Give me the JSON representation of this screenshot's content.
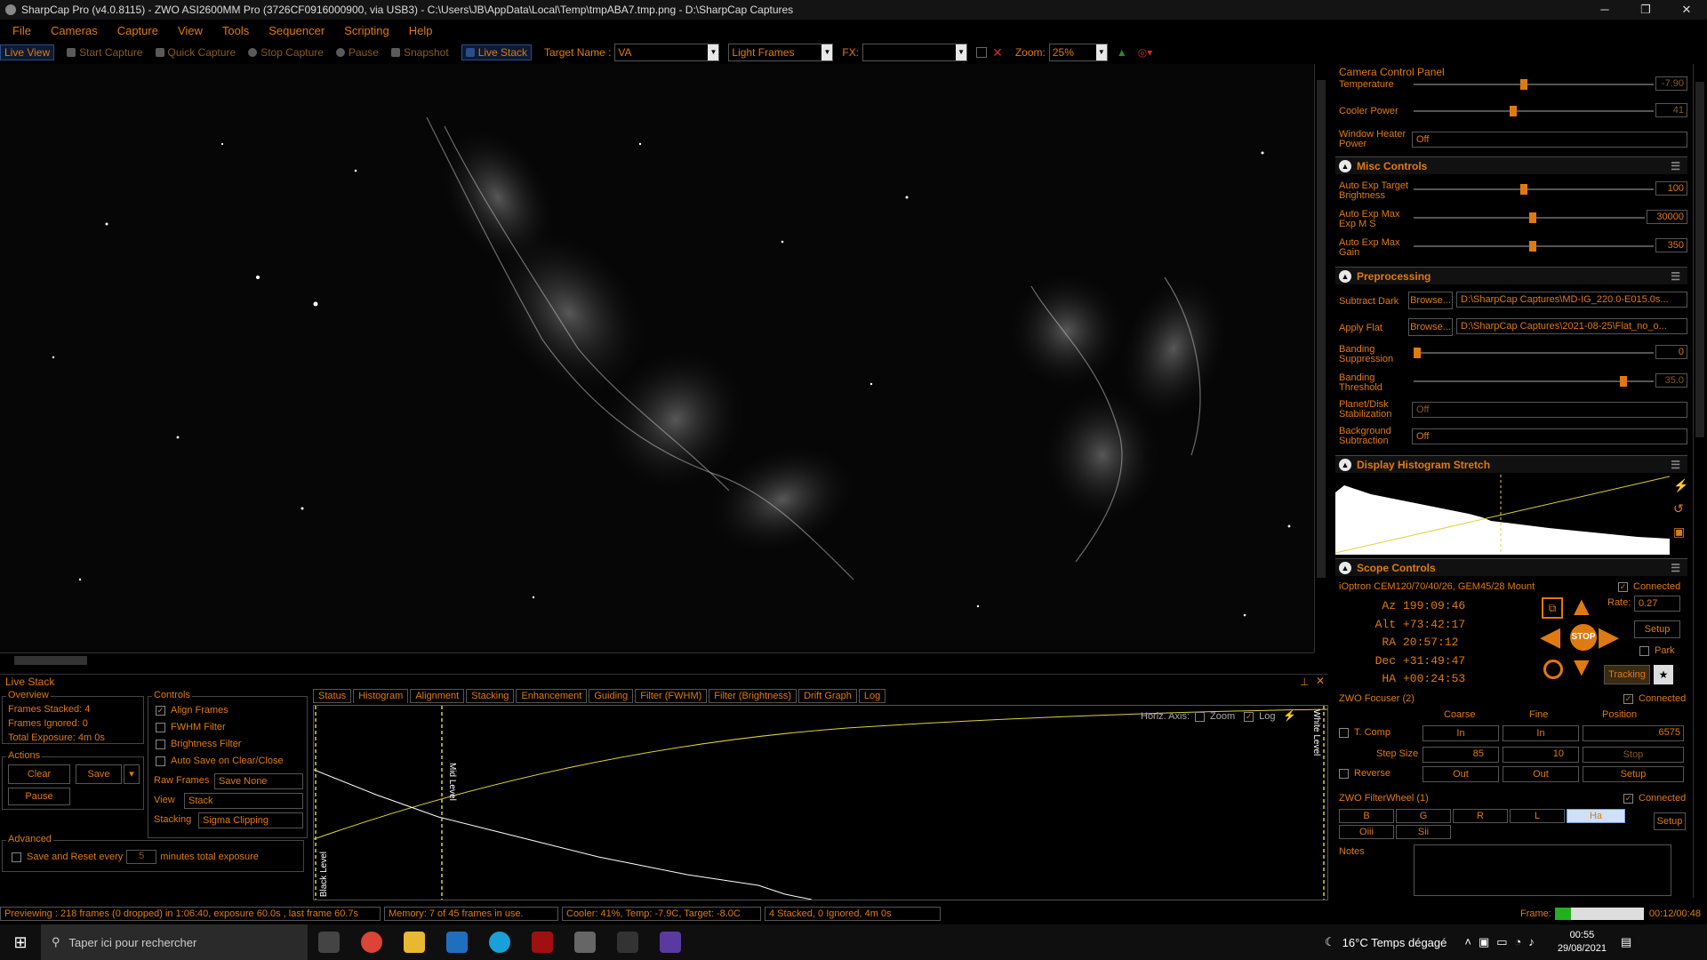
{
  "window": {
    "title": "SharpCap Pro (v4.0.8115) - ZWO ASI2600MM Pro (3726CF0916000900, via USB3) - C:\\Users\\JB\\AppData\\Local\\Temp\\tmpABA7.tmp.png - D:\\SharpCap Captures",
    "min": "─",
    "max": "❐",
    "close": "✕"
  },
  "menu": [
    "File",
    "Cameras",
    "Capture",
    "View",
    "Tools",
    "Sequencer",
    "Scripting",
    "Help"
  ],
  "toolbar": {
    "live_view": "Live View",
    "start_capture": "Start Capture",
    "quick_capture": "Quick Capture",
    "stop_capture": "Stop Capture",
    "pause": "Pause",
    "snapshot": "Snapshot",
    "live_stack": "Live Stack",
    "target_label": "Target Name :",
    "target_value": "VA",
    "frame_type": "Light Frames",
    "fx_label": "FX:",
    "fx_value": "",
    "zoom_label": "Zoom:",
    "zoom_value": "25%"
  },
  "camera_panel": {
    "title": "Camera Control Panel",
    "temperature_label": "Temperature",
    "temperature_value": "-7.90",
    "cooler_label": "Cooler Power",
    "cooler_value": "41",
    "heater_label": "Window Heater Power",
    "heater_value": "Off"
  },
  "misc": {
    "title": "Misc Controls",
    "ae_target_label": "Auto Exp Target Brightness",
    "ae_target_value": "100",
    "ae_maxexp_label": "Auto Exp Max Exp M S",
    "ae_maxexp_value": "30000",
    "ae_maxgain_label": "Auto Exp Max Gain",
    "ae_maxgain_value": "350"
  },
  "preproc": {
    "title": "Preprocessing",
    "dark_label": "Subtract Dark",
    "dark_browse": "Browse...",
    "dark_path": "D:\\SharpCap Captures\\MD-IG_220.0-E015.0s...",
    "flat_label": "Apply Flat",
    "flat_browse": "Browse...",
    "flat_path": "D:\\SharpCap Captures\\2021-08-25\\Flat_no_o...",
    "banding_sup_label": "Banding Suppression",
    "banding_sup_value": "0",
    "banding_thr_label": "Banding Threshold",
    "banding_thr_value": "35.0",
    "planet_label": "Planet/Disk Stabilization",
    "planet_value": "Off",
    "bg_label": "Background Subtraction",
    "bg_value": "Off"
  },
  "hist_stretch": {
    "title": "Display Histogram Stretch"
  },
  "scope": {
    "title": "Scope Controls",
    "mount": "iOptron CEM120/70/40/26, GEM45/28 Mount",
    "connected": "Connected",
    "az_label": "Az",
    "az": "199:09:46",
    "alt_label": "Alt",
    "alt": "+73:42:17",
    "ra_label": "RA",
    "ra": "20:57:12",
    "dec_label": "Dec",
    "dec": "+31:49:47",
    "ha_label": "HA",
    "ha": "+00:24:53",
    "rate_label": "Rate:",
    "rate": "0.27",
    "setup": "Setup",
    "park": "Park",
    "tracking": "Tracking",
    "stop": "STOP"
  },
  "focuser": {
    "title": "ZWO Focuser (2)",
    "connected": "Connected",
    "coarse": "Coarse",
    "fine": "Fine",
    "position": "Position",
    "tcomp": "T. Comp",
    "in1": "In",
    "in2": "In",
    "pos_value": "6575",
    "step_label": "Step Size",
    "step_coarse": "85",
    "step_fine": "10",
    "stop": "Stop",
    "reverse": "Reverse",
    "out1": "Out",
    "out2": "Out",
    "setup": "Setup"
  },
  "filterwheel": {
    "title": "ZWO FilterWheel (1)",
    "connected": "Connected",
    "filters": [
      "B",
      "G",
      "R",
      "L",
      "Ha"
    ],
    "filters2": [
      "Oiii",
      "Sii"
    ],
    "setup": "Setup"
  },
  "notes": {
    "label": "Notes"
  },
  "livestack": {
    "title": "Live Stack",
    "overview": "Overview",
    "stacked": "Frames Stacked: 4",
    "ignored": "Frames Ignored:  0",
    "exposure": "Total Exposure:   4m 0s",
    "actions": "Actions",
    "clear": "Clear",
    "save": "Save",
    "pause": "Pause",
    "advanced": "Advanced",
    "save_reset": "Save and Reset every",
    "save_reset_val": "5",
    "save_reset_unit": "minutes total exposure",
    "controls": "Controls",
    "align": "Align Frames",
    "fwhm": "FWHM Filter",
    "brightness": "Brightness Filter",
    "autosave": "Auto Save on Clear/Close",
    "raw_label": "Raw Frames",
    "raw_value": "Save None",
    "view_label": "View",
    "view_value": "Stack",
    "stacking_label": "Stacking",
    "stacking_value": "Sigma Clipping"
  },
  "tabs": [
    "Status",
    "Histogram",
    "Alignment",
    "Stacking",
    "Enhancement",
    "Guiding",
    "Filter (FWHM)",
    "Filter (Brightness)",
    "Drift Graph",
    "Log"
  ],
  "hist": {
    "horiz": "Horiz. Axis:",
    "zoom": "Zoom",
    "log": "Log",
    "black": "Black Level",
    "mid": "Mid Level",
    "white": "White Level"
  },
  "status": {
    "preview": "Previewing : 218 frames (0 dropped) in 1:06:40, exposure 60.0s , last frame 60.7s",
    "memory": "Memory: 7 of 45 frames in use.",
    "cooler": "Cooler: 41%, Temp: -7.9C, Target: -8.0C",
    "stack": "4 Stacked, 0 Ignored, 4m 0s",
    "frame_label": "Frame:",
    "frame_time": "00:12/00:48"
  },
  "taskbar": {
    "search": "Taper ici pour rechercher",
    "weather": "16°C  Temps dégagé",
    "time": "00:55",
    "date": "29/08/2021"
  }
}
